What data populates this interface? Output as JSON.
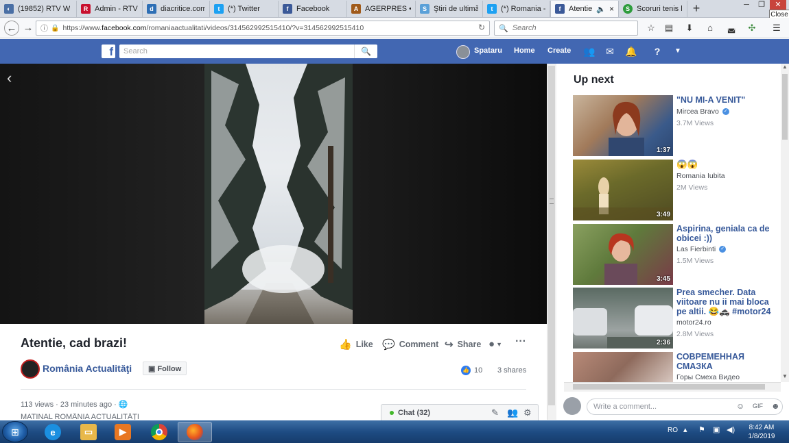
{
  "browser": {
    "tabs": [
      {
        "label": "(19852) RTV W",
        "fav_color": "#4a6fa5",
        "fav_glyph": "◐"
      },
      {
        "label": "Admin - RTV",
        "fav_color": "#c8102e",
        "fav_glyph": "R"
      },
      {
        "label": "diacritice.com",
        "fav_color": "#2d6fb5",
        "fav_glyph": "d"
      },
      {
        "label": "(*) Twitter",
        "fav_color": "#1da1f2",
        "fav_glyph": "t"
      },
      {
        "label": "Facebook",
        "fav_color": "#3b5998",
        "fav_glyph": "f"
      },
      {
        "label": "AGERPRES • A",
        "fav_color": "#a05a1a",
        "fav_glyph": "A"
      },
      {
        "label": "Ştiri de ultimă",
        "fav_color": "#5aa0d8",
        "fav_glyph": "S"
      },
      {
        "label": "(*) Romania -",
        "fav_color": "#1da1f2",
        "fav_glyph": "t"
      },
      {
        "label": "Atentie",
        "fav_color": "#3b5998",
        "fav_glyph": "f"
      },
      {
        "label": "Scoruri tenis l",
        "fav_color": "#2e9c3d",
        "fav_glyph": "S"
      }
    ],
    "new_tab": "+",
    "close_tooltip": "Close",
    "url_prefix": "https://www.",
    "url_domain": "facebook.com",
    "url_rest": "/romaniaactualitati/videos/314562992515410/?v=314562992515410",
    "search_placeholder": "Search",
    "icons": [
      "back-icon",
      "forward-icon",
      "info-icon",
      "lock-icon",
      "reload-icon",
      "search-icon",
      "star-icon",
      "reading-list-icon",
      "download-icon",
      "home-icon",
      "pocket-icon",
      "extension-icon",
      "menu-icon"
    ]
  },
  "fb_header": {
    "logo": "f",
    "search_placeholder": "Search",
    "user": "Spataru",
    "home": "Home",
    "create": "Create"
  },
  "post": {
    "title": "Atentie, cad brazi!",
    "actions": {
      "like": "Like",
      "comment": "Comment",
      "share": "Share"
    },
    "page_name": "România Actualităţi",
    "follow": "Follow",
    "like_count": "10",
    "shares": "3 shares",
    "meta": "113 views · 23 minutes ago · ",
    "description": "MATINAL ROMÂNIA ACTUALITĂŢI"
  },
  "chat": {
    "label": "Chat (32)"
  },
  "up_next": {
    "title": "Up next",
    "videos": [
      {
        "title": "\"NU MI-A VENIT\"",
        "author": "Mircea Bravo",
        "verified": true,
        "views": "3.7M Views",
        "duration": "1:37"
      },
      {
        "title": "😱😱",
        "author": "Romania Iubita",
        "verified": false,
        "views": "2M Views",
        "duration": "3:49"
      },
      {
        "title": "Aspirina, geniala ca de obicei :))",
        "author": "Las Fierbinti",
        "verified": true,
        "views": "1.5M Views",
        "duration": "3:45"
      },
      {
        "title": "Prea smecher. Data viitoare nu ii mai bloca pe altii. 😂🚓 #motor24",
        "author": "motor24.ro",
        "verified": false,
        "views": "2.8M Views",
        "duration": "2:36"
      },
      {
        "title": "СОВРЕМЕННАЯ СМАЗКА",
        "author": "Горы Смеха Видео",
        "verified": false,
        "views": "",
        "duration": ""
      }
    ]
  },
  "comment": {
    "placeholder": "Write a comment..."
  },
  "taskbar": {
    "lang": "RO",
    "time": "8:42 AM",
    "date": "1/8/2019"
  }
}
